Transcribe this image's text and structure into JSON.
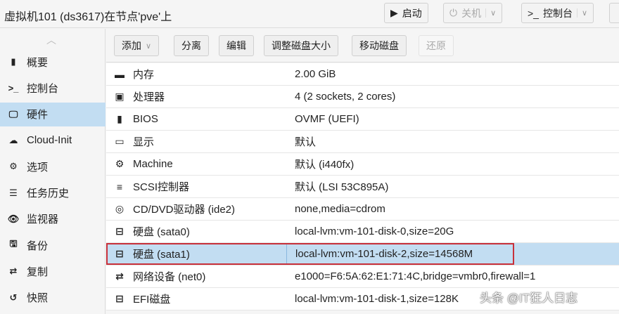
{
  "header": {
    "title": "虚拟机101 (ds3617)在节点'pve'上",
    "start": "启动",
    "shutdown": "关机",
    "console": "控制台"
  },
  "sidebar": {
    "items": [
      {
        "label": "概要",
        "icon": "book-icon",
        "glyph": "▮"
      },
      {
        "label": "控制台",
        "icon": "terminal-icon",
        "glyph": ">_"
      },
      {
        "label": "硬件",
        "icon": "monitor-icon",
        "glyph": "🖵",
        "selected": true
      },
      {
        "label": "Cloud-Init",
        "icon": "cloud-icon",
        "glyph": "☁"
      },
      {
        "label": "选项",
        "icon": "gear-icon",
        "glyph": "⚙"
      },
      {
        "label": "任务历史",
        "icon": "list-icon",
        "glyph": "☰"
      },
      {
        "label": "监视器",
        "icon": "eye-icon",
        "glyph": "👁"
      },
      {
        "label": "备份",
        "icon": "save-icon",
        "glyph": "🖫"
      },
      {
        "label": "复制",
        "icon": "retweet-icon",
        "glyph": "⇄"
      },
      {
        "label": "快照",
        "icon": "history-icon",
        "glyph": "↺"
      }
    ]
  },
  "toolbar": {
    "add": "添加",
    "detach": "分离",
    "edit": "编辑",
    "resize": "调整磁盘大小",
    "move": "移动磁盘",
    "revert": "还原"
  },
  "rows": [
    {
      "icon": "memory-icon",
      "glyph": "▬",
      "key": "内存",
      "value": "2.00 GiB"
    },
    {
      "icon": "cpu-icon",
      "glyph": "▣",
      "key": "处理器",
      "value": "4 (2 sockets, 2 cores)"
    },
    {
      "icon": "microchip-icon",
      "glyph": "▮",
      "key": "BIOS",
      "value": "OVMF (UEFI)"
    },
    {
      "icon": "desktop-icon",
      "glyph": "▭",
      "key": "显示",
      "value": "默认"
    },
    {
      "icon": "cogs-icon",
      "glyph": "⚙",
      "key": "Machine",
      "value": "默认 (i440fx)"
    },
    {
      "icon": "database-icon",
      "glyph": "≡",
      "key": "SCSI控制器",
      "value": "默认 (LSI 53C895A)"
    },
    {
      "icon": "cdrom-icon",
      "glyph": "◎",
      "key": "CD/DVD驱动器 (ide2)",
      "value": "none,media=cdrom"
    },
    {
      "icon": "hdd-icon",
      "glyph": "⊟",
      "key": "硬盘 (sata0)",
      "value": "local-lvm:vm-101-disk-0,size=20G"
    },
    {
      "icon": "hdd-icon",
      "glyph": "⊟",
      "key": "硬盘 (sata1)",
      "value": "local-lvm:vm-101-disk-2,size=14568M",
      "selected": true
    },
    {
      "icon": "exchange-icon",
      "glyph": "⇄",
      "key": "网络设备 (net0)",
      "value": "e1000=F6:5A:62:E1:71:4C,bridge=vmbr0,firewall=1"
    },
    {
      "icon": "hdd-icon",
      "glyph": "⊟",
      "key": "EFI磁盘",
      "value": "local-lvm:vm-101-disk-1,size=128K"
    }
  ],
  "watermark": "头条 @IT狂人日志"
}
